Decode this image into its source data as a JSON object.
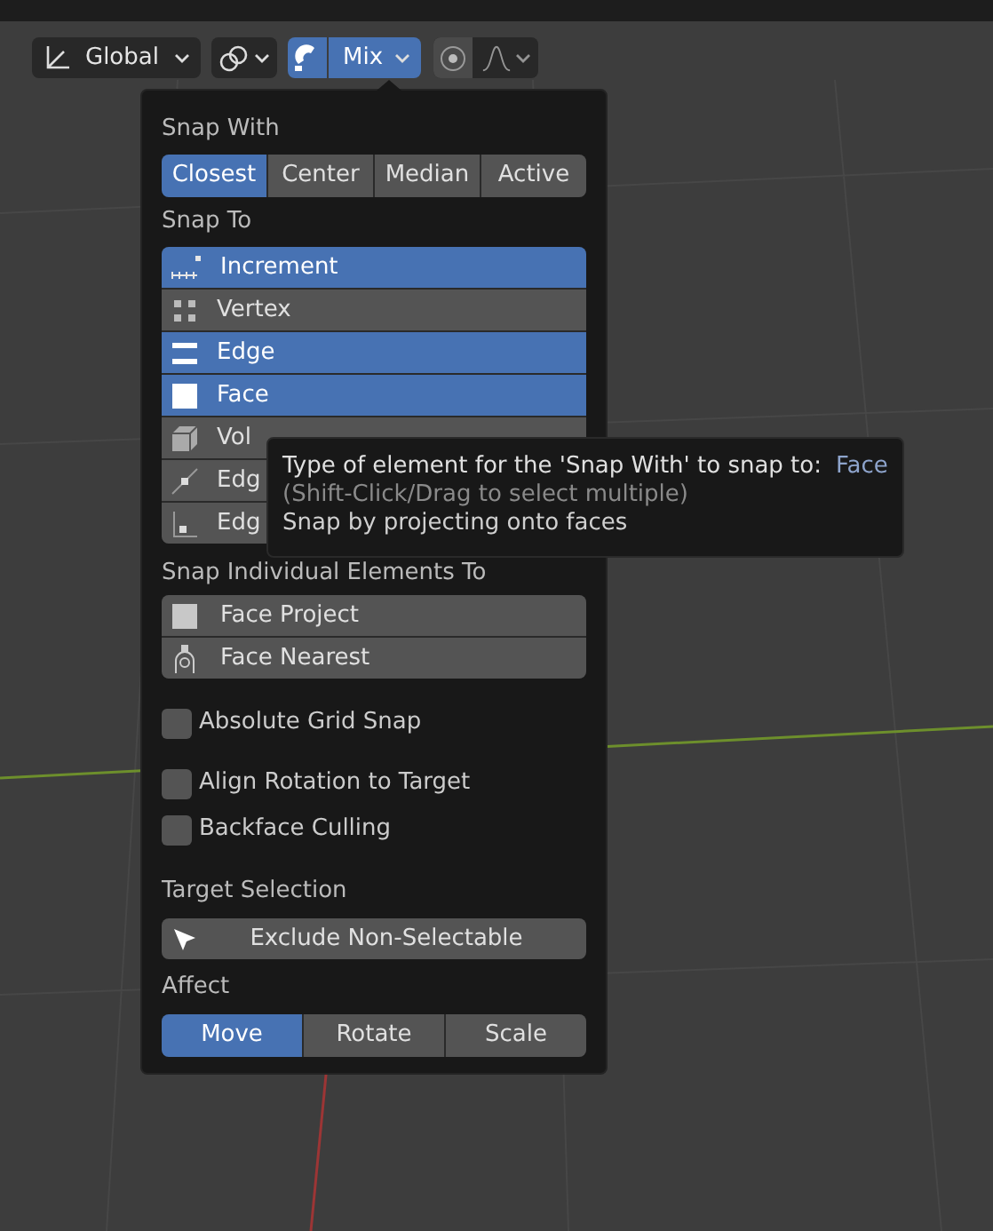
{
  "toolbar": {
    "orientation": {
      "label": "Global"
    },
    "snap": {
      "on": true,
      "label": "Mix"
    },
    "proportional_edit": {
      "on": false
    }
  },
  "popup": {
    "snap_with": {
      "title": "Snap With",
      "options": [
        {
          "label": "Closest",
          "selected": true
        },
        {
          "label": "Center",
          "selected": false
        },
        {
          "label": "Median",
          "selected": false
        },
        {
          "label": "Active",
          "selected": false
        }
      ]
    },
    "snap_to": {
      "title": "Snap To",
      "items": [
        {
          "label": "Increment",
          "selected": true
        },
        {
          "label": "Vertex",
          "selected": false
        },
        {
          "label": "Edge",
          "selected": true
        },
        {
          "label": "Face",
          "selected": true
        },
        {
          "label": "Vol",
          "selected": false
        },
        {
          "label": "Edg",
          "selected": false
        },
        {
          "label": "Edg",
          "selected": false
        }
      ]
    },
    "snap_individual": {
      "title": "Snap Individual Elements To",
      "items": [
        {
          "label": "Face Project",
          "selected": false
        },
        {
          "label": "Face Nearest",
          "selected": false
        }
      ]
    },
    "checkboxes": [
      {
        "label": "Absolute Grid Snap",
        "checked": false
      },
      {
        "label": "Align Rotation to Target",
        "checked": false
      },
      {
        "label": "Backface Culling",
        "checked": false
      }
    ],
    "target_selection": {
      "title": "Target Selection",
      "button": "Exclude Non-Selectable"
    },
    "affect": {
      "title": "Affect",
      "options": [
        {
          "label": "Move",
          "selected": true
        },
        {
          "label": "Rotate",
          "selected": false
        },
        {
          "label": "Scale",
          "selected": false
        }
      ]
    }
  },
  "tooltip": {
    "text": "Type of element for the 'Snap With' to snap to:",
    "value": "Face",
    "hint": "(Shift-Click/Drag to select multiple)",
    "description": "Snap by projecting onto faces"
  }
}
